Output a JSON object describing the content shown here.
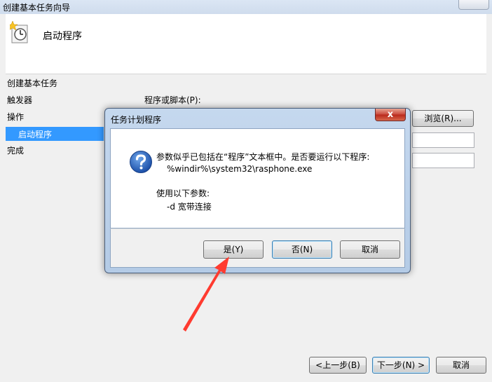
{
  "window": {
    "title": "创建基本任务向导",
    "header_title": "启动程序"
  },
  "nav": {
    "section": "创建基本任务",
    "trigger": "触发器",
    "action": "操作",
    "action_child": "启动程序",
    "finish": "完成"
  },
  "form": {
    "program_label": "程序或脚本(P):",
    "browse_label": "浏览(R)..."
  },
  "footer": {
    "back_label": "<上一步(B)",
    "next_label": "下一步(N) >",
    "cancel_label": "取消"
  },
  "dialog": {
    "title": "任务计划程序",
    "message_line1": "参数似乎已包括在“程序”文本框中。是否要运行以下程序:",
    "program_path": "%windir%\\system32\\rasphone.exe",
    "params_label": "使用以下参数:",
    "params_value": "-d 宽带连接",
    "yes_label": "是(Y)",
    "no_label": "否(N)",
    "cancel_label": "取消",
    "close_glyph": "x"
  },
  "colors": {
    "selection": "#3399ff",
    "annotation_arrow": "#ff3b30"
  },
  "icons": {
    "header": "scheduled-task-clock-icon",
    "dialog": "question-icon",
    "annotation": "red-arrow"
  }
}
